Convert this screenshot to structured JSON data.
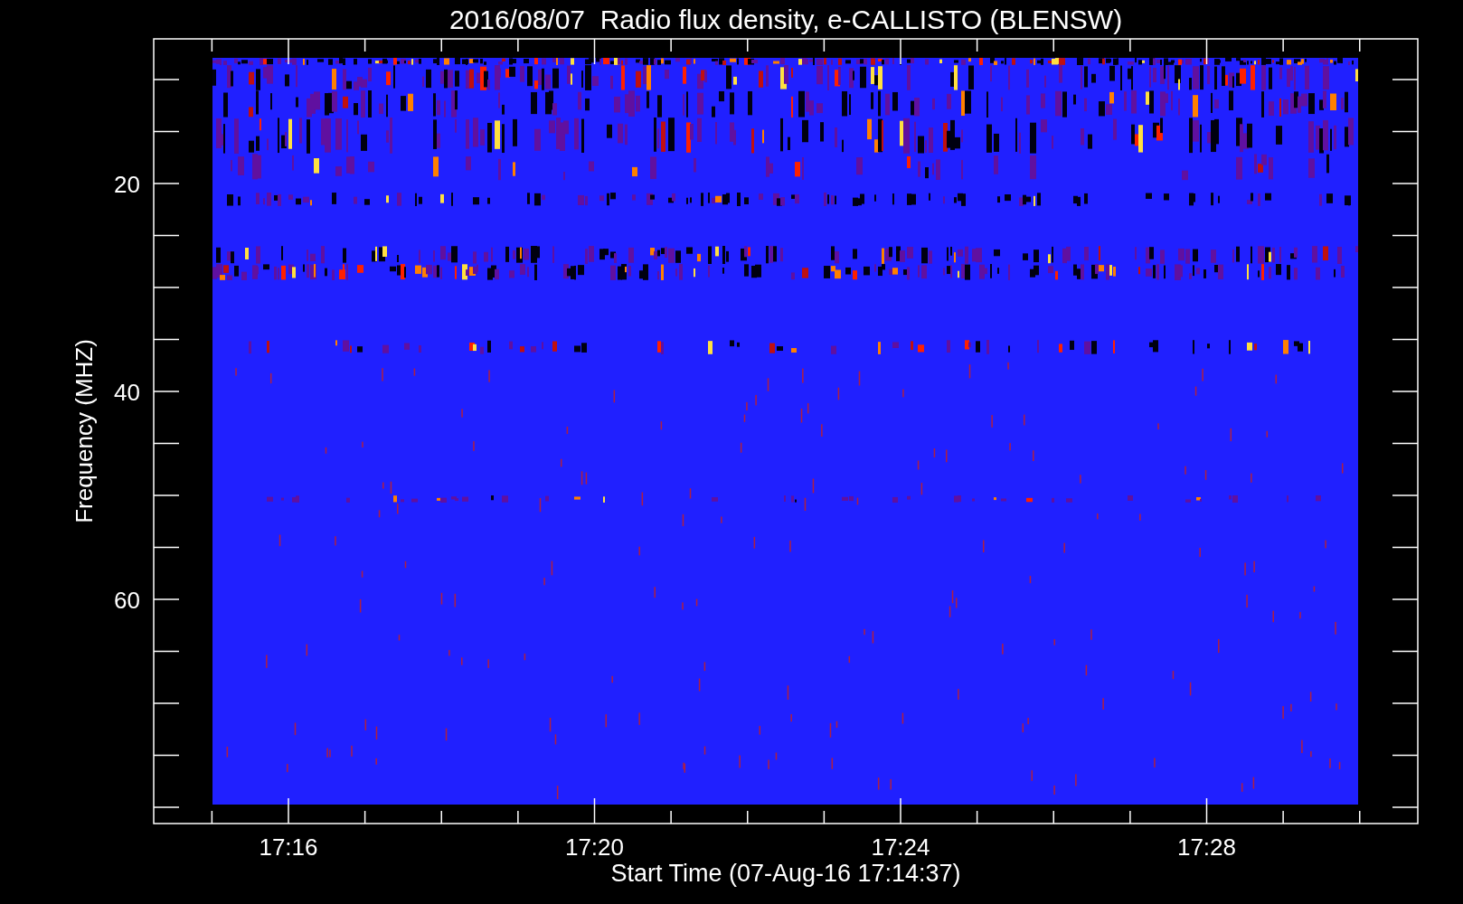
{
  "title": "2016/08/07  Radio flux density, e-CALLISTO (BLENSW)",
  "x_axis": {
    "label": "Start Time (07-Aug-16 17:14:37)",
    "ticks": [
      "17:16",
      "17:20",
      "17:24",
      "17:28"
    ]
  },
  "y_axis": {
    "label": "Frequency (MHZ)",
    "ticks": [
      "20",
      "40",
      "60"
    ]
  }
}
